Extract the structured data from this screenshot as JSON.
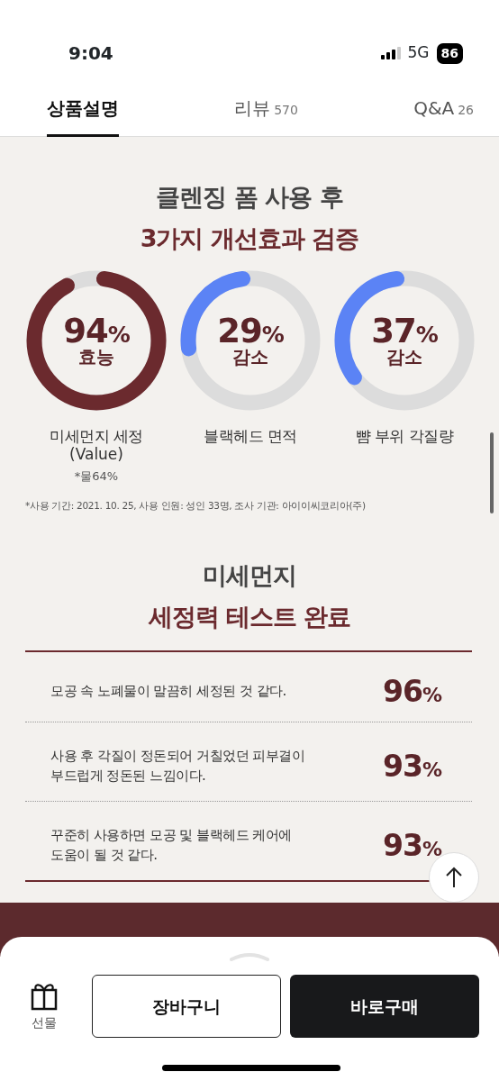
{
  "status_bar": {
    "time": "9:04",
    "network": "5G",
    "battery": "86"
  },
  "tabs": [
    {
      "label": "상품설명",
      "selected": true
    },
    {
      "label": "리뷰",
      "count": "570",
      "selected": false
    },
    {
      "label": "Q&A",
      "count": "26",
      "selected": false
    }
  ],
  "section1": {
    "title_lines": [
      "클렌징 폼 사용 후",
      "3가지 개선효과 검증"
    ],
    "gauges": [
      {
        "value": "94",
        "unit": "%",
        "caption": "효능",
        "label": "미세먼지 세정",
        "sublabel": "(Value)",
        "note": "*물64%",
        "color": "#6b2a2e",
        "kind": "efficacy"
      },
      {
        "value": "29",
        "unit": "%",
        "caption": "감소",
        "label": "블랙헤드 면적",
        "color": "#5b83f5",
        "kind": "reduction"
      },
      {
        "value": "37",
        "unit": "%",
        "caption": "감소",
        "label": "뺨 부위 각질량",
        "color": "#5b83f5",
        "kind": "reduction"
      }
    ],
    "footnote": "*사용 기간: 2021. 10. 25, 사용 인원: 성인 33명, 조사 기관: 아이이씨코리아(주)"
  },
  "section2": {
    "title_lines": [
      "미세먼지",
      "세정력 테스트 완료"
    ],
    "rows": [
      {
        "lines": [
          "모공 속 노폐물이 말끔히 세정된 것 같다."
        ],
        "value": "96",
        "unit": "%"
      },
      {
        "lines": [
          "사용 후 각질이 정돈되어 거칠었던 피부결이",
          "부드럽게 정돈된 느낌이다."
        ],
        "value": "93",
        "unit": "%"
      },
      {
        "lines": [
          "꾸준히 사용하면 모공 및 블랙헤드 케어에",
          "도움이 될 것 같다."
        ],
        "value": "93",
        "unit": "%"
      }
    ]
  },
  "bottom_bar": {
    "gift_label": "선물",
    "cart_button": "장바구니",
    "buy_button": "바로구매"
  }
}
